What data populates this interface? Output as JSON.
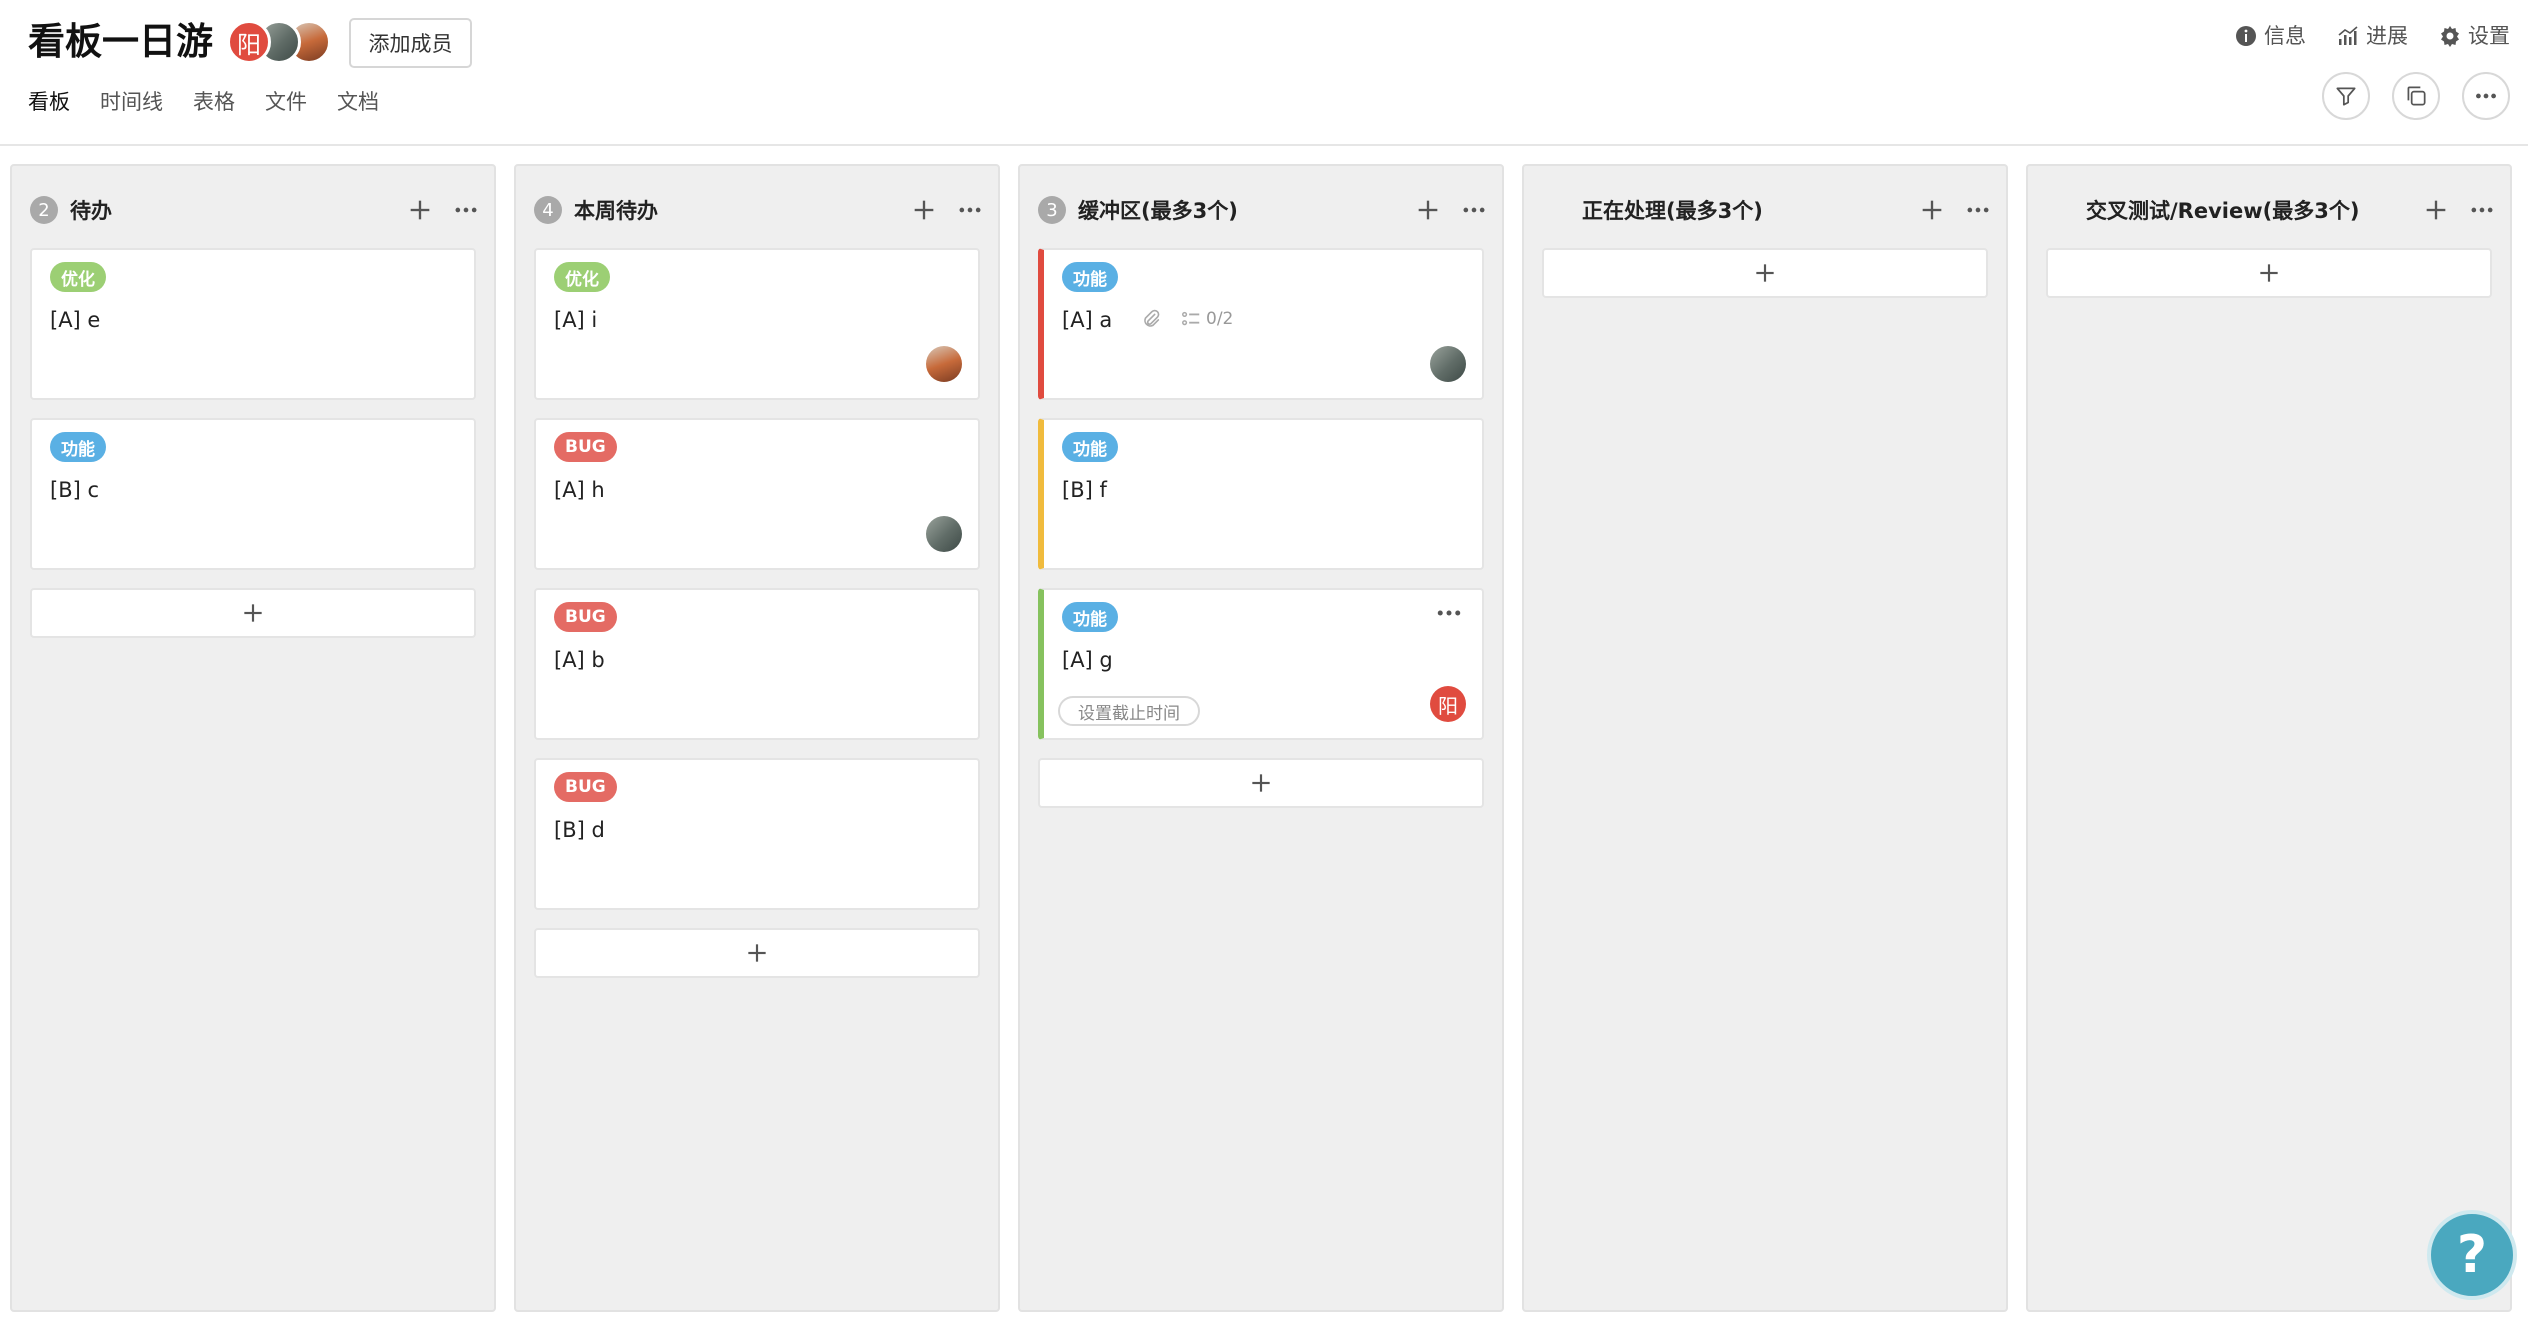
{
  "header": {
    "title": "看板一日游",
    "member_initial": "阳",
    "add_member_label": "添加成员",
    "views": [
      "看板",
      "时间线",
      "表格",
      "文件",
      "文档"
    ],
    "active_view": "看板",
    "links": {
      "info": "信息",
      "progress": "进展",
      "settings": "设置"
    }
  },
  "colors": {
    "tag_optimize": "#9ccf74",
    "tag_bug": "#e46b64",
    "tag_feature": "#5ab0e4",
    "accent_red": "#e04b3f",
    "accent_yellow": "#f0bb3d",
    "accent_green": "#86c25e",
    "help_button": "#4aa8bf"
  },
  "columns": [
    {
      "count": "2",
      "title": "待办",
      "cards": [
        {
          "tag": "优化",
          "title": "[A] e"
        },
        {
          "tag": "功能",
          "title": "[B] c"
        }
      ]
    },
    {
      "count": "4",
      "title": "本周待办",
      "cards": [
        {
          "tag": "优化",
          "title": "[A] i",
          "avatar": "photo-orange"
        },
        {
          "tag": "BUG",
          "title": "[A] h",
          "avatar": "photo-gray"
        },
        {
          "tag": "BUG",
          "title": "[A] b"
        },
        {
          "tag": "BUG",
          "title": "[B] d"
        }
      ]
    },
    {
      "count": "3",
      "title": "缓冲区(最多3个)",
      "cards": [
        {
          "tag": "功能",
          "title": "[A] a",
          "checklist": "0/2",
          "avatar": "photo-gray"
        },
        {
          "tag": "功能",
          "title": "[B] f"
        },
        {
          "tag": "功能",
          "title": "[A] g",
          "due_label": "设置截止时间",
          "avatar_initial": "阳"
        }
      ]
    },
    {
      "count": "",
      "title": "正在处理(最多3个)",
      "cards": []
    },
    {
      "count": "",
      "title": "交叉测试/Review(最多3个)",
      "cards": []
    }
  ],
  "help": {
    "label": "?"
  }
}
